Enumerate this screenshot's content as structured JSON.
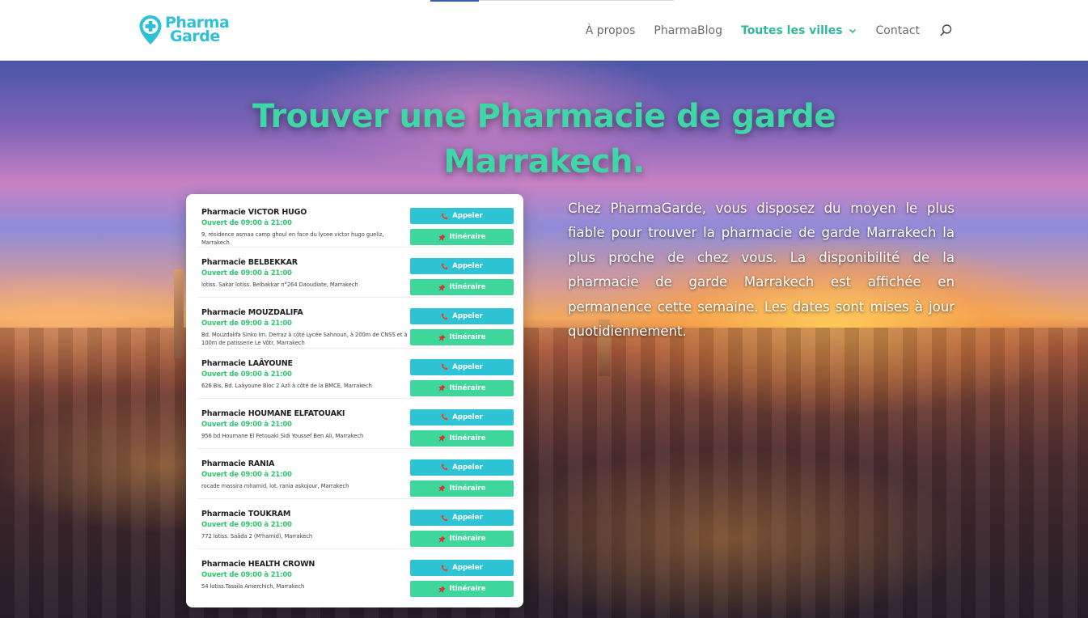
{
  "header": {
    "logo_line1": "Pharma",
    "logo_line2": "Garde",
    "nav": [
      {
        "label": "À propos"
      },
      {
        "label": "PharmaBlog"
      },
      {
        "label": "Toutes les villes"
      },
      {
        "label": "Contact"
      }
    ],
    "accent_color": "#2fb89a",
    "brand_color": "#2fc0d6"
  },
  "hero": {
    "title": "Trouver une Pharmacie de garde Marrakech.",
    "description": "Chez PharmaGarde, vous disposez du moyen le plus fiable pour trouver la pharmacie de garde Marrakech la plus proche de chez vous. La disponibilité de la pharmacie de garde Marrakech est affichée en permanence cette semaine. Les dates sont mises à jour quotidiennement."
  },
  "buttons": {
    "call_label": "Appeler",
    "route_label": "Itinéraire"
  },
  "pharmacies": [
    {
      "name": "Pharmacie VICTOR HUGO",
      "hours": "Ouvert de 09:00 à 21:00",
      "address": "9, résidence asmaa camp ghoul en face du lycee victor hugo gueliz, Marrakech"
    },
    {
      "name": "Pharmacie BELBEKKAR",
      "hours": "Ouvert de 09:00 à 21:00",
      "address": "lotiss. Sakar lotiss. Belbakkar n°264 Daoudiate, Marrakech"
    },
    {
      "name": "Pharmacie MOUZDALIFA",
      "hours": "Ouvert de 09:00 à 21:00",
      "address": "Bd. Mouzdalifa Sinko Im. Derraz à côté Lycée Sahnoun, à 200m de CNSS et à 100m de patisserie Le Vôtr, Marrakech"
    },
    {
      "name": "Pharmacie LAÂYOUNE",
      "hours": "Ouvert de 09:00 à 21:00",
      "address": "626 Bis, Bd. Laâyoune Bloc 2 Azli à côté de la BMCE, Marrakech"
    },
    {
      "name": "Pharmacie HOUMANE ELFATOUAKI",
      "hours": "Ouvert de 09:00 à 21:00",
      "address": "956 bd Houmane El Fetouaki Sidi Youssef Ben Ali, Marrakech"
    },
    {
      "name": "Pharmacie RANIA",
      "hours": "Ouvert de 09:00 à 21:00",
      "address": "rocade massira mhamid, lot. rania askojour, Marrakech"
    },
    {
      "name": "Pharmacie TOUKRAM",
      "hours": "Ouvert de 09:00 à 21:00",
      "address": "772 lotiss. Saâda 2 (M'hamid), Marrakech"
    },
    {
      "name": "Pharmacie HEALTH CROWN",
      "hours": "Ouvert de 09:00 à 21:00",
      "address": "54 lotiss.Tassila Amerchich, Marrakech"
    }
  ]
}
